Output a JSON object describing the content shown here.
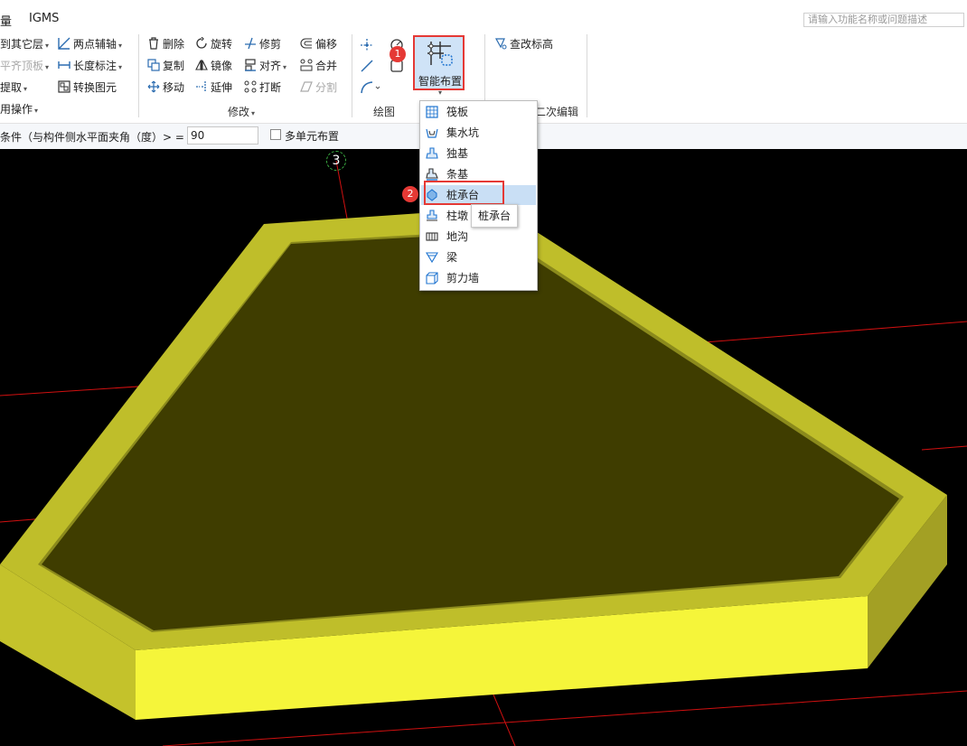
{
  "menu": {
    "left_partial": "量",
    "igms": "IGMS"
  },
  "search": {
    "placeholder": "请输入功能名称或问题描述"
  },
  "groups": {
    "general": {
      "items": [
        "到其它层",
        "平齐顶板",
        "提取",
        "用操作"
      ],
      "col2": [
        "两点辅轴",
        "长度标注",
        "转换图元"
      ]
    },
    "modify": {
      "label": "修改",
      "col1": [
        "删除",
        "复制",
        "移动"
      ],
      "col2": [
        "旋转",
        "镜像",
        "延伸"
      ],
      "col3": [
        "修剪",
        "对齐",
        "打断"
      ],
      "col4": [
        "偏移",
        "合并",
        "分割"
      ]
    },
    "draw": {
      "label": "绘图"
    },
    "smart": {
      "label": "智能布置"
    },
    "secondary": {
      "check_elev": "查改标高",
      "partial_label": "二次编辑"
    }
  },
  "options": {
    "condition_label": "条件（与构件侧水平面夹角（度）> = ）",
    "angle_value": "90",
    "multi_unit_label": "多单元布置"
  },
  "dropdown": {
    "items": [
      "筏板",
      "集水坑",
      "独基",
      "条基",
      "桩承台",
      "柱墩",
      "地沟",
      "梁",
      "剪力墙"
    ],
    "highlighted_index": 4
  },
  "tooltip": "桩承台",
  "badges": {
    "one": "1",
    "two": "2"
  },
  "axis_marker": "3",
  "colors": {
    "accent_red": "#e53935",
    "ribbon_hover": "#cfe3f7",
    "slab_top": "#3f3d00",
    "slab_rim": "#bfbe2a",
    "slab_front": "#f5f53a",
    "slab_side": "#a3a024",
    "grid_line": "#d01010"
  }
}
